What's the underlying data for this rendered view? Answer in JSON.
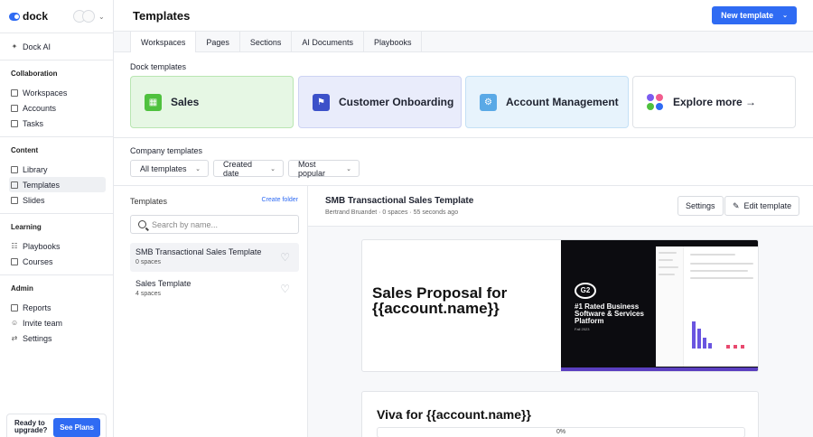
{
  "brand": {
    "name": "dock"
  },
  "sidebar": {
    "dock_ai": "Dock AI",
    "sections": [
      {
        "title": "Collaboration",
        "items": [
          "Workspaces",
          "Accounts",
          "Tasks"
        ]
      },
      {
        "title": "Content",
        "items": [
          "Library",
          "Templates",
          "Slides"
        ]
      },
      {
        "title": "Learning",
        "items": [
          "Playbooks",
          "Courses"
        ]
      },
      {
        "title": "Admin",
        "items": [
          "Reports",
          "Invite team",
          "Settings"
        ]
      }
    ],
    "upgrade_text": "Ready to upgrade?",
    "see_plans": "See Plans"
  },
  "header": {
    "title": "Templates",
    "new_template": "New template"
  },
  "tabs": [
    "Workspaces",
    "Pages",
    "Sections",
    "AI Documents",
    "Playbooks"
  ],
  "dock_templates": {
    "title": "Dock templates",
    "cards": [
      "Sales",
      "Customer Onboarding",
      "Account Management",
      "Explore more →"
    ]
  },
  "company_templates": {
    "title": "Company templates",
    "filters": [
      "All templates",
      "Created date",
      "Most popular"
    ]
  },
  "list": {
    "header": "Templates",
    "create_folder": "Create folder",
    "search_placeholder": "Search by name...",
    "items": [
      {
        "name": "SMB Transactional Sales Template",
        "sub": "0 spaces"
      },
      {
        "name": "Sales Template",
        "sub": "4 spaces"
      }
    ]
  },
  "detail": {
    "title": "SMB Transactional Sales Template",
    "meta": "Bertrand Bruandet · 0 spaces · 55 seconds ago",
    "settings": "Settings",
    "edit": "Edit template"
  },
  "preview": {
    "page1_title": "Sales Proposal for {{account.name}}",
    "g2_badge": "G2",
    "g2_text": "#1 Rated Business Software & Services Platform",
    "g2_date": "Fall 2023",
    "page2_title": "Viva for {{account.name}}",
    "progress": "0%"
  },
  "colors": {
    "accent": "#2f6bf3",
    "sales": "#4fc13e",
    "onboarding": "#3c51c9",
    "account": "#5aa9e6"
  }
}
